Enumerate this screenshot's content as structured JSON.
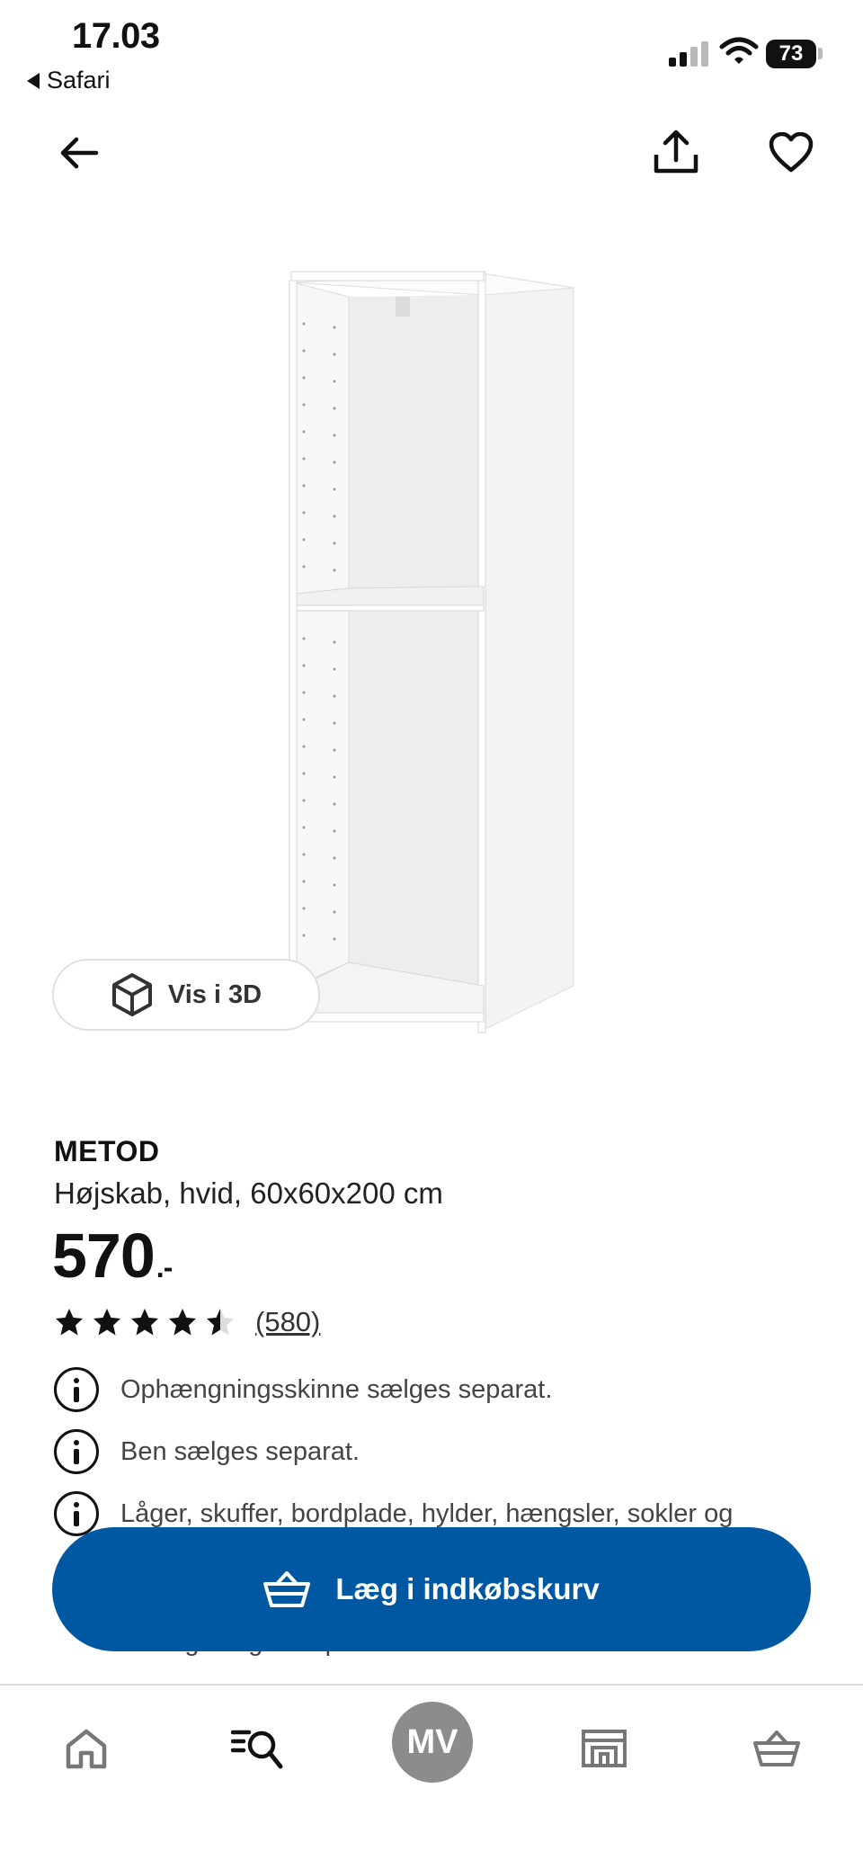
{
  "status_bar": {
    "time": "17.03",
    "back_app": "Safari",
    "battery": "73"
  },
  "toolbar": {
    "back_icon": "arrow-left-icon",
    "share_icon": "share-icon",
    "favorite_icon": "heart-icon"
  },
  "view3d": {
    "label": "Vis i 3D",
    "icon": "cube-icon"
  },
  "product": {
    "brand": "METOD",
    "description": "Højskab, hvid, 60x60x200 cm",
    "price": "570",
    "price_suffix": ".-",
    "rating": 4.5,
    "rating_max": 5,
    "review_count": "(580)"
  },
  "info_notes": [
    "Ophængningsskinne sælges separat.",
    "Ben sælges separat.",
    "Låger, skuffer, bordplade, hylder, hængsler, sokler og",
    "beslag sælges separat."
  ],
  "cart_button": {
    "label": "Læg i indkøbskurv",
    "icon": "basket-icon"
  },
  "bottom_nav": {
    "items": [
      {
        "name": "home-icon"
      },
      {
        "name": "search-icon"
      },
      {
        "name": "profile",
        "initials": "MV"
      },
      {
        "name": "store-icon"
      },
      {
        "name": "basket-icon"
      }
    ]
  },
  "colors": {
    "accent": "#0058a3",
    "text": "#111111",
    "muted": "#444444"
  }
}
